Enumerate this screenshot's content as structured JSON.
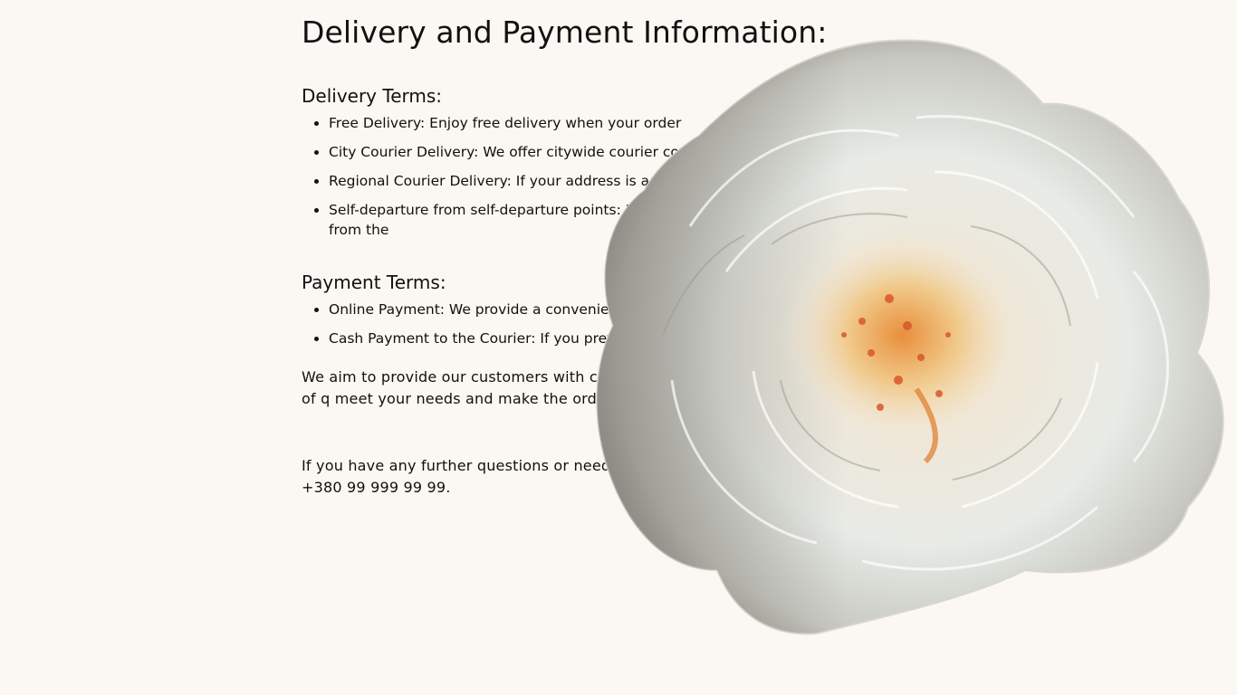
{
  "page": {
    "title": "Delivery and Payment Information:",
    "delivery": {
      "heading": "Delivery Terms:",
      "items": [
        "Free Delivery: Enjoy free delivery when your order",
        "City Courier Delivery: We offer citywide courier convenient time and place",
        "Regional Courier Delivery: If your address is across the region to ensure the utmost con",
        "Self-departure from self-departure points: If yo can use the service of self-departure from the"
      ]
    },
    "payment": {
      "heading": "Payment Terms:",
      "items": [
        "Online Payment: We provide a convenie website. You can use your credit card or o",
        "Cash Payment to the Courier: If you prefe delivers your order. Please ensure you h"
      ]
    },
    "summary": "We aim to provide our customers with conv payment process, along with a guarantee of q meet your needs and make the ordering process",
    "contact": "If you have any further questions or need additional informat ch out to our manager at +380 99 999 99 99."
  },
  "decoration": {
    "image": "white-rose-painting",
    "colors": {
      "background": "#fbf7f2",
      "petal_light": "#eef0ec",
      "petal_shadow": "#8f8c84",
      "center": "#f0c98a",
      "accent": "#d9572b"
    }
  }
}
